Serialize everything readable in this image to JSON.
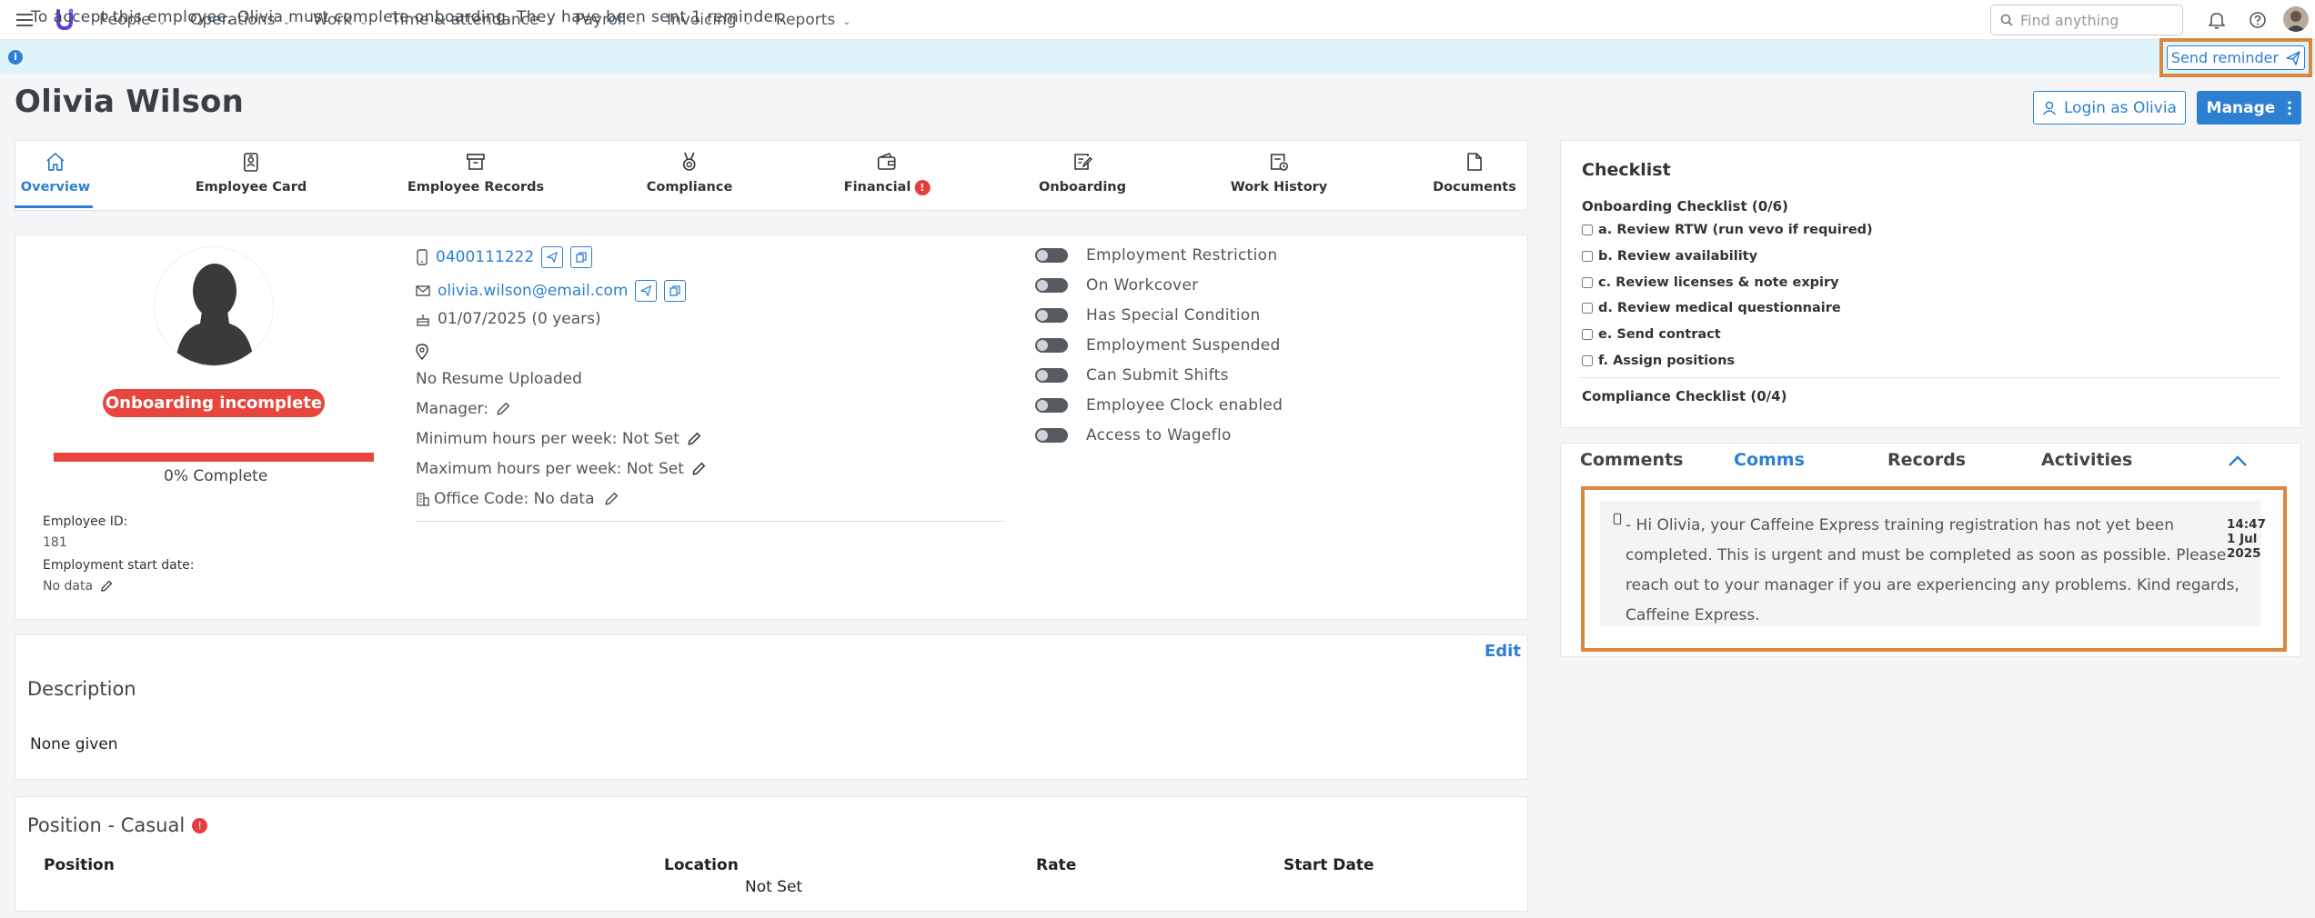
{
  "nav": {
    "items": [
      "People",
      "Operations",
      "Work",
      "Time & attendance",
      "Payroll",
      "Invoicing",
      "Reports"
    ],
    "search_placeholder": "Find anything"
  },
  "banner": {
    "text": "To accept this employee, Olivia must complete onboarding. They have been sent 1 reminder.",
    "send_reminder": "Send reminder"
  },
  "header": {
    "name": "Olivia Wilson",
    "login_as": "Login as Olivia",
    "manage": "Manage"
  },
  "tabs": [
    {
      "label": "Overview",
      "icon": "home-icon",
      "active": true
    },
    {
      "label": "Employee Card",
      "icon": "id-badge-icon"
    },
    {
      "label": "Employee Records",
      "icon": "archive-icon"
    },
    {
      "label": "Compliance",
      "icon": "medal-icon"
    },
    {
      "label": "Financial",
      "icon": "wallet-icon",
      "badge": "!"
    },
    {
      "label": "Onboarding",
      "icon": "clipboard-edit-icon"
    },
    {
      "label": "Work History",
      "icon": "history-icon"
    },
    {
      "label": "Documents",
      "icon": "document-icon"
    }
  ],
  "profile": {
    "status": "Onboarding incomplete",
    "progress_pct": 0,
    "progress_label": "0% Complete",
    "employee_id_label": "Employee ID:",
    "employee_id": "181",
    "start_date_label": "Employment start date:",
    "start_date": "No data"
  },
  "contact": {
    "phone": "0400111222",
    "email": "olivia.wilson@email.com",
    "birthday": "01/07/2025 (0 years)",
    "resume": "No Resume Uploaded",
    "manager": "Manager:",
    "min_hours": "Minimum hours per week: Not Set",
    "max_hours": "Maximum hours per week: Not Set",
    "office_code": "Office Code: No data"
  },
  "toggles": [
    "Employment Restriction",
    "On Workcover",
    "Has Special Condition",
    "Employment Suspended",
    "Can Submit Shifts",
    "Employee Clock enabled",
    "Access to Wageflo"
  ],
  "checklist": {
    "title": "Checklist",
    "onboarding_title": "Onboarding Checklist (0/6)",
    "items": [
      "a. Review RTW (run vevo if required)",
      "b. Review availability",
      "c. Review licenses & note expiry",
      "d. Review medical questionnaire",
      "e. Send contract",
      "f. Assign positions"
    ],
    "compliance_title": "Compliance Checklist (0/4)"
  },
  "comms": {
    "tabs": [
      "Comments",
      "Comms",
      "Records",
      "Activities"
    ],
    "message_lines": [
      "- Hi Olivia, your Caffeine Express training registration has not yet been",
      "completed. This is urgent and must be completed as soon as possible. Please",
      "reach out to your manager if you are experiencing any problems. Kind regards,",
      "Caffeine Express."
    ],
    "time": "14:47",
    "date_line1": "1 Jul",
    "date_line2": "2025"
  },
  "description": {
    "edit": "Edit",
    "title": "Description",
    "body": "None given"
  },
  "position": {
    "title": "Position - Casual",
    "columns": [
      "Position",
      "Location",
      "Rate",
      "Start Date"
    ],
    "empty": "Not Set"
  },
  "colors": {
    "accent": "#2d7fd1",
    "danger": "#e8453c",
    "highlight": "#d9883f",
    "banner_bg": "#dff3fb"
  }
}
